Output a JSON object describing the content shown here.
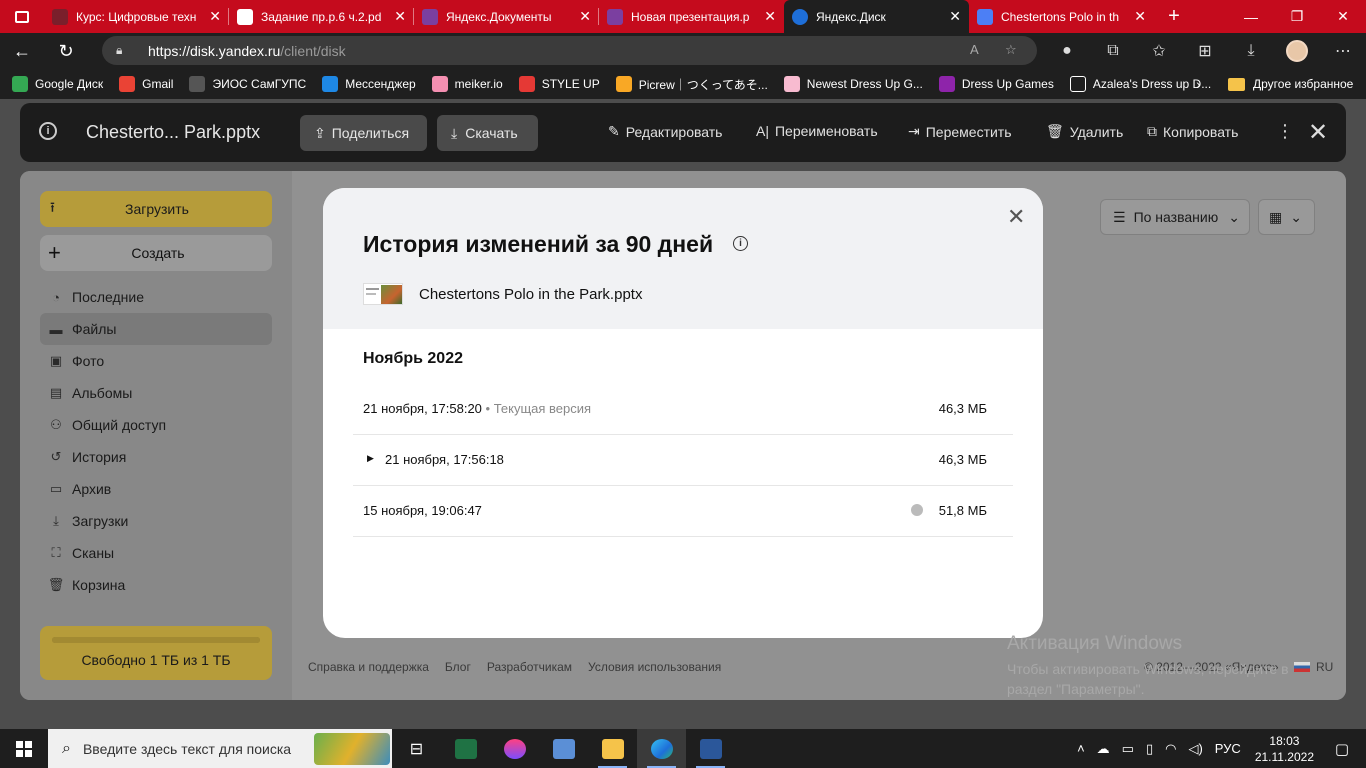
{
  "browser": {
    "tabs": [
      {
        "title": "Курс: Цифровые техн",
        "favicon_color": "#7a1f2b"
      },
      {
        "title": "Задание пр.р.6 ч.2.pd",
        "favicon_color": "#ffffff"
      },
      {
        "title": "Яндекс.Документы",
        "favicon_color": "#7b3fa0"
      },
      {
        "title": "Новая презентация.p",
        "favicon_color": "#7b3fa0"
      },
      {
        "title": "Яндекс.Диск",
        "favicon_color": "#1e6fd9",
        "active": true
      },
      {
        "title": "Chestertons Polo in th",
        "favicon_color": "#4c7ff5"
      }
    ],
    "url_host": "https://disk.yandex.ru",
    "url_path": "/client/disk",
    "bookmarks": [
      {
        "label": "Google Диск",
        "color": "#34a853"
      },
      {
        "label": "Gmail",
        "color": "#ea4335"
      },
      {
        "label": "ЭИОС СамГУПС",
        "color": "#333333"
      },
      {
        "label": "Мессенджер",
        "color": "#1e88e5"
      },
      {
        "label": "meiker.io",
        "color": "#f48fb1"
      },
      {
        "label": "STYLE UP",
        "color": "#e53935"
      },
      {
        "label": "Picrew｜つくってあそ...",
        "color": "#f9a825"
      },
      {
        "label": "Newest Dress Up G...",
        "color": "#f8bbd0"
      },
      {
        "label": "Dress Up Games",
        "color": "#8e24aa"
      },
      {
        "label": "Azalea's Dress up D...",
        "color": "#ffffff"
      }
    ],
    "bookmarks_other": "Другое избранное"
  },
  "topbar": {
    "file_name": "Chesterto... Park.pptx",
    "share": "Поделиться",
    "download": "Скачать",
    "edit": "Редактировать",
    "rename": "Переименовать",
    "move": "Переместить",
    "delete": "Удалить",
    "copy": "Копировать"
  },
  "sidebar": {
    "upload": "Загрузить",
    "create": "Создать",
    "items": [
      {
        "label": "Последние",
        "icon": "clock-icon"
      },
      {
        "label": "Файлы",
        "icon": "folder-icon",
        "active": true
      },
      {
        "label": "Фото",
        "icon": "photo-icon"
      },
      {
        "label": "Альбомы",
        "icon": "albums-icon"
      },
      {
        "label": "Общий доступ",
        "icon": "people-icon"
      },
      {
        "label": "История",
        "icon": "history-icon"
      },
      {
        "label": "Архив",
        "icon": "archive-icon"
      },
      {
        "label": "Загрузки",
        "icon": "download-icon"
      },
      {
        "label": "Сканы",
        "icon": "scan-icon"
      },
      {
        "label": "Корзина",
        "icon": "trash-icon"
      }
    ],
    "quota_label": "Свободно 1 ТБ из 1 ТБ",
    "quota_used_fraction": 1.0
  },
  "content": {
    "sort_label": "По названию"
  },
  "footer": {
    "links": [
      "Справка и поддержка",
      "Блог",
      "Разработчикам",
      "Условия использования"
    ],
    "copyright": "© 2012—2022 «Яндекс»",
    "lang": "RU"
  },
  "modal": {
    "title": "История изменений за 90 дней",
    "file_name": "Chestertons Polo in the Park.pptx",
    "month": "Ноябрь 2022",
    "versions": [
      {
        "date": "21 ноября, 17:58:20",
        "note": " • Текущая версия",
        "size": "46,3 МБ"
      },
      {
        "date": "21 ноября, 17:56:18",
        "size": "46,3 МБ"
      },
      {
        "date": "15 ноября, 19:06:47",
        "size": "51,8 МБ"
      }
    ]
  },
  "activation": {
    "title": "Активация Windows",
    "text1": "Чтобы активировать Windows, перейдите в",
    "text2": "раздел \"Параметры\"."
  },
  "taskbar": {
    "search_placeholder": "Введите здесь текст для поиска",
    "lang": "РУС",
    "time": "18:03",
    "date": "21.11.2022"
  }
}
